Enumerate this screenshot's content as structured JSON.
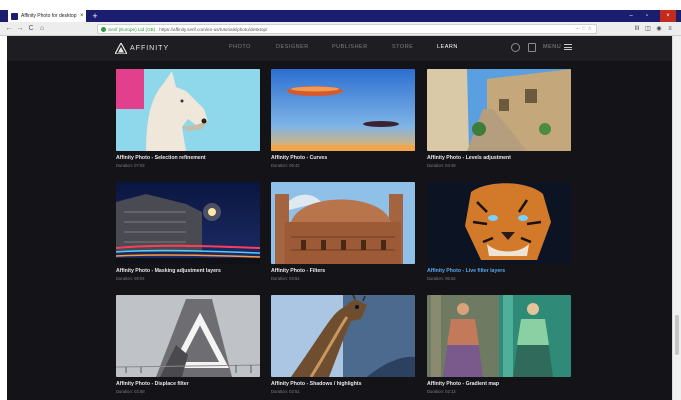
{
  "browser": {
    "tab_title": "Affinity Photo for desktop tuto",
    "tab_close": "×",
    "new_tab": "+",
    "site_identity": "Serif (Europe) Ltd (GB)",
    "url": "https://affinity.serif.com/en-us/tutorials/photo/desktop/",
    "url_actions": "··· ♡ ☆",
    "nav": {
      "back": "←",
      "forward": "→",
      "reload": "C",
      "home": "⌂"
    },
    "window": {
      "min": "–",
      "max": "▫",
      "close": "×"
    },
    "toolbar": [
      "III",
      "◫",
      "◉",
      "≡"
    ]
  },
  "site": {
    "logo_text": "AFFINITY",
    "nav_items": [
      {
        "label": "PHOTO"
      },
      {
        "label": "DESIGNER"
      },
      {
        "label": "PUBLISHER"
      },
      {
        "label": "STORE"
      },
      {
        "label": "LEARN"
      }
    ],
    "menu_label": "MENU"
  },
  "tutorials": [
    {
      "title": "Affinity Photo - Selection refinement",
      "duration": "Duration: 07:03"
    },
    {
      "title": "Affinity Photo - Curves",
      "duration": "Duration: 06:42"
    },
    {
      "title": "Affinity Photo - Levels adjustment",
      "duration": "Duration: 04:49"
    },
    {
      "title": "Affinity Photo - Masking adjustment layers",
      "duration": "Duration: 09:04"
    },
    {
      "title": "Affinity Photo - Filters",
      "duration": "Duration: 03:54"
    },
    {
      "title": "Affinity Photo - Live filter layers",
      "duration": "Duration: 06:52"
    },
    {
      "title": "Affinity Photo - Displace filter",
      "duration": "Duration: 02:58"
    },
    {
      "title": "Affinity Photo - Shadows / highlights",
      "duration": "Duration: 02:51"
    },
    {
      "title": "Affinity Photo - Gradient map",
      "duration": "Duration: 02:13"
    }
  ],
  "colors": {
    "tabbar": "#1b1e6e",
    "site_bg": "#141418",
    "highlight_title": "#52a8f0"
  }
}
